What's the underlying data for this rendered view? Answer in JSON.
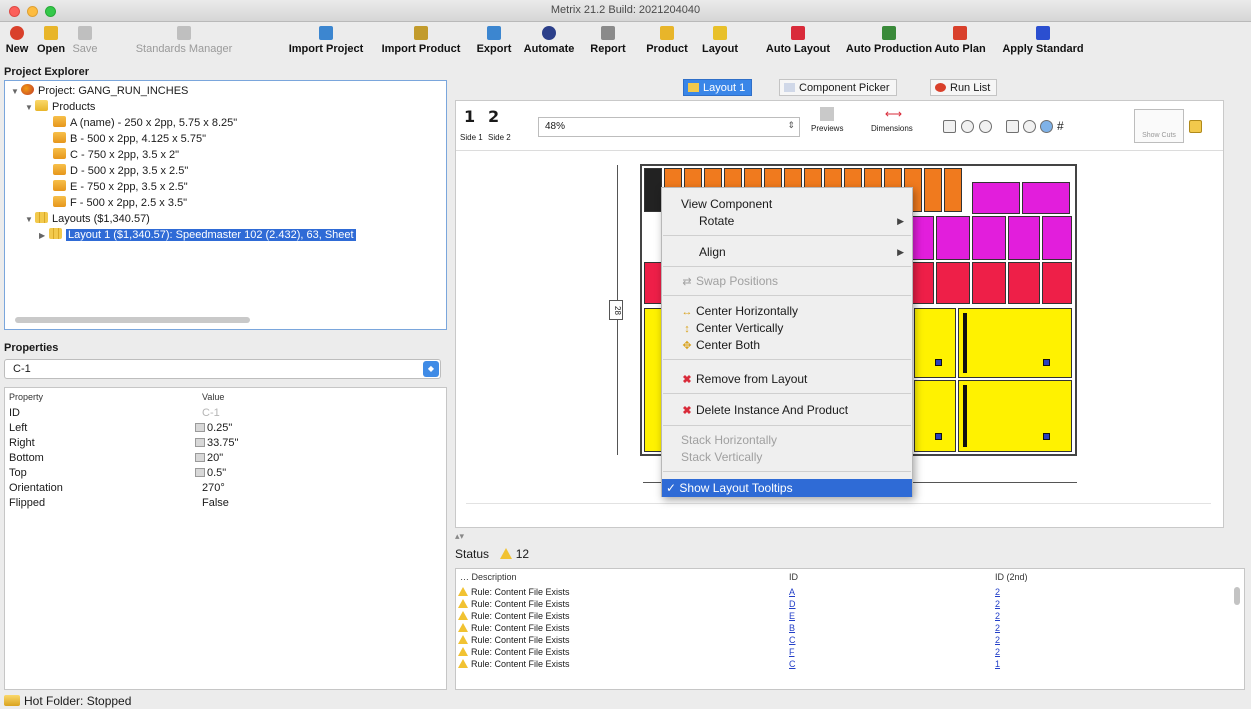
{
  "window": {
    "title": "Metrix 21.2 Build: 2021204040"
  },
  "toolbar": {
    "buttons": [
      {
        "label": "New",
        "icon": "new-icon",
        "color": "#d9402b"
      },
      {
        "label": "Open",
        "icon": "open-icon",
        "color": "#e8b52a"
      },
      {
        "label": "Save",
        "icon": "save-icon",
        "color": "#8a8a8a"
      },
      {
        "label": "Standards Manager",
        "icon": "standards-icon",
        "color": "#8a8a8a"
      },
      {
        "label": "Import Project",
        "icon": "import-project-icon",
        "color": "#3c86d0"
      },
      {
        "label": "Import Product",
        "icon": "import-product-icon",
        "color": "#c29b2c"
      },
      {
        "label": "Export",
        "icon": "export-icon",
        "color": "#3c86d0"
      },
      {
        "label": "Automate",
        "icon": "automate-icon",
        "color": "#2b3f8a"
      },
      {
        "label": "Report",
        "icon": "report-icon",
        "color": "#8a8a8a"
      },
      {
        "label": "Product",
        "icon": "product-icon",
        "color": "#e8b52a"
      },
      {
        "label": "Layout",
        "icon": "layout-icon",
        "color": "#e8c02a"
      },
      {
        "label": "Auto Layout",
        "icon": "auto-layout-icon",
        "color": "#d92b3a"
      },
      {
        "label": "Auto Production",
        "icon": "auto-production-icon",
        "color": "#3a8a3a"
      },
      {
        "label": "Auto Plan",
        "icon": "auto-plan-icon",
        "color": "#d9402b"
      },
      {
        "label": "Apply Standard",
        "icon": "apply-standard-icon",
        "color": "#2b4fd0"
      }
    ]
  },
  "project_explorer": {
    "title": "Project Explorer",
    "project": "Project: GANG_RUN_INCHES",
    "products_label": "Products",
    "products": [
      "A (name) - 250 x 2pp, 5.75 x 8.25\"",
      "B - 500 x 2pp, 4.125 x 5.75\"",
      "C - 750 x 2pp, 3.5 x 2\"",
      "D - 500 x 2pp, 3.5 x 2.5\"",
      "E - 750 x 2pp, 3.5 x 2.5\"",
      "F - 500 x 2pp, 2.5 x 3.5\""
    ],
    "layouts_label": "Layouts ($1,340.57)",
    "layout_item": "Layout 1 ($1,340.57): Speedmaster 102 (2.432), 63, Sheet"
  },
  "properties": {
    "title": "Properties",
    "selected": "C-1",
    "col_property": "Property",
    "col_value": "Value",
    "rows": [
      {
        "name": "ID",
        "value": "C-1"
      },
      {
        "name": "Left",
        "value": "0.25\""
      },
      {
        "name": "Right",
        "value": "33.75\""
      },
      {
        "name": "Bottom",
        "value": "20\""
      },
      {
        "name": "Top",
        "value": "0.5\""
      },
      {
        "name": "Orientation",
        "value": "270°"
      },
      {
        "name": "Flipped",
        "value": "False"
      }
    ]
  },
  "tabs": [
    {
      "label": "Layout 1",
      "active": true
    },
    {
      "label": "Component Picker",
      "active": false
    },
    {
      "label": "Run List",
      "active": false
    }
  ],
  "layout_toolbar": {
    "side1_num": "1",
    "side2_num": "2",
    "side1_label": "Side 1",
    "side2_label": "Side 2",
    "zoom": "48%",
    "previews": "Previews",
    "dimensions": "Dimensions",
    "show_cuts": "Show Cuts"
  },
  "sheet": {
    "dim_label": "28"
  },
  "context_menu": {
    "view_component": "View Component",
    "rotate": "Rotate",
    "align": "Align",
    "swap_positions": "Swap Positions",
    "center_h": "Center Horizontally",
    "center_v": "Center Vertically",
    "center_both": "Center Both",
    "remove": "Remove from Layout",
    "delete": "Delete Instance And Product",
    "stack_h": "Stack Horizontally",
    "stack_v": "Stack Vertically",
    "show_tooltips": "✓ Show Layout Tooltips"
  },
  "status": {
    "label": "Status",
    "count": "12",
    "col_desc": "Description",
    "col_id": "ID",
    "col_id2": "ID (2nd)",
    "rows": [
      {
        "desc": "Rule: Content File Exists",
        "id": "A",
        "id2": "2"
      },
      {
        "desc": "Rule: Content File Exists",
        "id": "D",
        "id2": "2"
      },
      {
        "desc": "Rule: Content File Exists",
        "id": "E",
        "id2": "2"
      },
      {
        "desc": "Rule: Content File Exists",
        "id": "B",
        "id2": "2"
      },
      {
        "desc": "Rule: Content File Exists",
        "id": "C",
        "id2": "2"
      },
      {
        "desc": "Rule: Content File Exists",
        "id": "F",
        "id2": "2"
      },
      {
        "desc": "Rule: Content File Exists",
        "id": "C",
        "id2": "1"
      }
    ]
  },
  "footer": {
    "hot_folder": "Hot Folder: Stopped"
  }
}
